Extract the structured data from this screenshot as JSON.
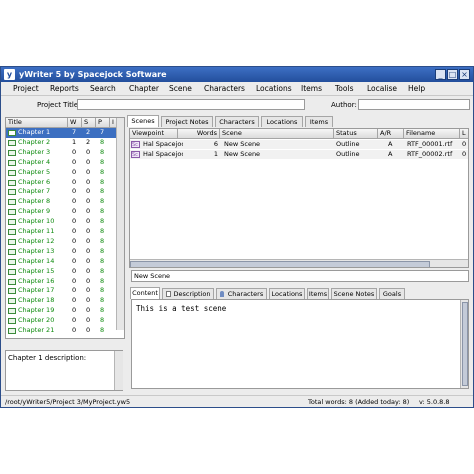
{
  "window": {
    "title": "yWriter 5 by Spacejock Software",
    "app_icon_letter": "y",
    "minimize": "_",
    "maximize": "□",
    "close": "×"
  },
  "menu": [
    "Project",
    "Reports",
    "Search",
    "Chapter",
    "Scene",
    "Characters",
    "Locations",
    "Items",
    "Tools",
    "Localise",
    "Help"
  ],
  "project": {
    "title_label": "Project Title:",
    "title_value": "",
    "author_label": "Author:",
    "author_value": ""
  },
  "chapters": {
    "headers": [
      "Title",
      "W",
      "S",
      "P",
      "I"
    ],
    "rows": [
      {
        "title": "Chapter 1",
        "w": "7",
        "s": "2",
        "p": "7"
      },
      {
        "title": "Chapter 2",
        "w": "1",
        "s": "2",
        "p": "8"
      },
      {
        "title": "Chapter 3",
        "w": "0",
        "s": "0",
        "p": "8"
      },
      {
        "title": "Chapter 4",
        "w": "0",
        "s": "0",
        "p": "8"
      },
      {
        "title": "Chapter 5",
        "w": "0",
        "s": "0",
        "p": "8"
      },
      {
        "title": "Chapter 6",
        "w": "0",
        "s": "0",
        "p": "8"
      },
      {
        "title": "Chapter 7",
        "w": "0",
        "s": "0",
        "p": "8"
      },
      {
        "title": "Chapter 8",
        "w": "0",
        "s": "0",
        "p": "8"
      },
      {
        "title": "Chapter 9",
        "w": "0",
        "s": "0",
        "p": "8"
      },
      {
        "title": "Chapter 10",
        "w": "0",
        "s": "0",
        "p": "8"
      },
      {
        "title": "Chapter 11",
        "w": "0",
        "s": "0",
        "p": "8"
      },
      {
        "title": "Chapter 12",
        "w": "0",
        "s": "0",
        "p": "8"
      },
      {
        "title": "Chapter 13",
        "w": "0",
        "s": "0",
        "p": "8"
      },
      {
        "title": "Chapter 14",
        "w": "0",
        "s": "0",
        "p": "8"
      },
      {
        "title": "Chapter 15",
        "w": "0",
        "s": "0",
        "p": "8"
      },
      {
        "title": "Chapter 16",
        "w": "0",
        "s": "0",
        "p": "8"
      },
      {
        "title": "Chapter 17",
        "w": "0",
        "s": "0",
        "p": "8"
      },
      {
        "title": "Chapter 18",
        "w": "0",
        "s": "0",
        "p": "8"
      },
      {
        "title": "Chapter 19",
        "w": "0",
        "s": "0",
        "p": "8"
      },
      {
        "title": "Chapter 20",
        "w": "0",
        "s": "0",
        "p": "8"
      },
      {
        "title": "Chapter 21",
        "w": "0",
        "s": "0",
        "p": "8"
      }
    ]
  },
  "chapter_description_label": "Chapter 1 description:",
  "top_tabs": [
    "Scenes",
    "Project Notes",
    "Characters",
    "Locations",
    "Items"
  ],
  "scenes": {
    "headers": [
      "Viewpoint",
      "Words",
      "Scene",
      "Status",
      "A/R",
      "Filename",
      "L"
    ],
    "rows": [
      {
        "icon": "Sc",
        "viewpoint": "Hal Spacejock",
        "words": "6",
        "scene": "New Scene",
        "status": "Outline",
        "ar": "A",
        "filename": "RTF_00001.rtf",
        "l": "0"
      },
      {
        "icon": "Sc",
        "viewpoint": "Hal Spacejock",
        "words": "1",
        "scene": "New Scene",
        "status": "Outline",
        "ar": "A",
        "filename": "RTF_00002.rtf",
        "l": "0"
      }
    ]
  },
  "scene_title": "New Scene",
  "bottom_tabs": [
    "Content",
    "Description",
    "Characters",
    "Locations",
    "Items",
    "Scene Notes",
    "Goals"
  ],
  "content_text": "This is a test scene",
  "status": {
    "path": "/root/yWriter5/Project 3/MyProject.yw5",
    "words": "Total words: 8 (Added today: 8)",
    "version": "v: 5.0.8.8"
  },
  "colors": {
    "selected": "#3c6fc1",
    "chapter_green": "#0d8a0d",
    "titlebar": "#2c5bab"
  }
}
